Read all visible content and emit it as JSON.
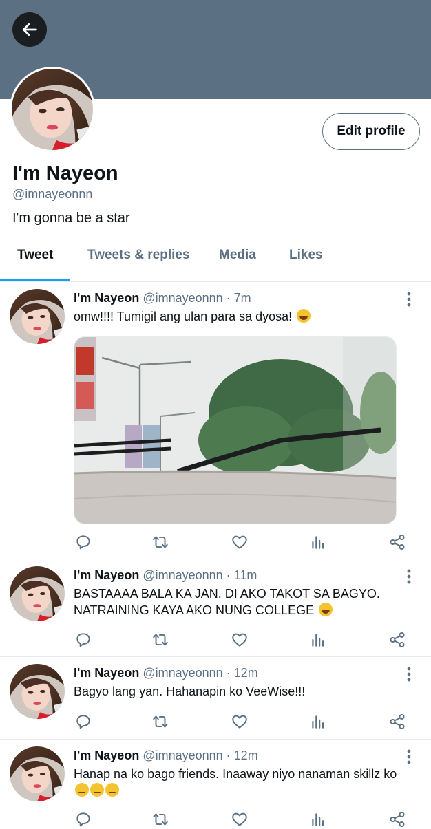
{
  "profile": {
    "name": "I'm Nayeon",
    "handle": "@imnayeonnn",
    "bio": "I'm gonna be a star",
    "edit_label": "Edit profile",
    "banner_color": "#5b7083"
  },
  "tabs": [
    {
      "label": "Tweet",
      "active": true
    },
    {
      "label": "Tweets & replies",
      "active": false
    },
    {
      "label": "Media",
      "active": false
    },
    {
      "label": "Likes",
      "active": false
    }
  ],
  "tweets": [
    {
      "name": "I'm Nayeon",
      "handle": "@imnayeonnn",
      "time": "7m",
      "text": "omw!!!! Tumigil ang ulan para sa dyosa!",
      "emoji": "rolling-on-floor-laughing",
      "has_media": true
    },
    {
      "name": "I'm Nayeon",
      "handle": "@imnayeonnn",
      "time": "11m",
      "text": "BASTAAAA BALA KA JAN. DI AKO TAKOT SA BAGYO. NATRAINING KAYA AKO NUNG COLLEGE",
      "emoji": "rolling-on-floor-laughing",
      "has_media": false
    },
    {
      "name": "I'm Nayeon",
      "handle": "@imnayeonnn",
      "time": "12m",
      "text": "Bagyo lang yan. Hahanapin ko VeeWise!!!",
      "has_media": false
    },
    {
      "name": "I'm Nayeon",
      "handle": "@imnayeonnn",
      "time": "12m",
      "text": "Hanap na ko bago friends. Inaaway niyo nanaman skillz ko",
      "emoji": "unamused-face x3",
      "has_media": false
    }
  ],
  "meta_separator": " · ",
  "icons": [
    "back-arrow-icon",
    "more-vertical-icon",
    "reply-icon",
    "retweet-icon",
    "like-icon",
    "analytics-icon",
    "share-icon"
  ],
  "colors": {
    "accent": "#1d9bf0",
    "secondary_text": "#5b7083",
    "border": "#e6ecf0"
  }
}
